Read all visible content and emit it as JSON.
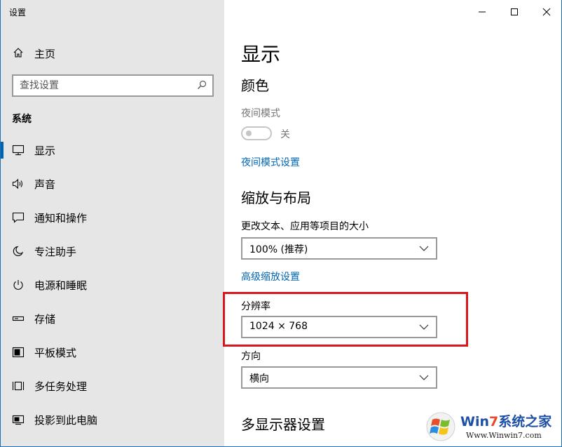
{
  "window": {
    "title": "设置",
    "controls": [
      "minimize",
      "maximize",
      "close"
    ]
  },
  "sidebar": {
    "home_label": "主页",
    "search_placeholder": "查找设置",
    "section_title": "系统",
    "items": [
      {
        "label": "显示",
        "icon": "monitor-icon",
        "active": true
      },
      {
        "label": "声音",
        "icon": "speaker-icon"
      },
      {
        "label": "通知和操作",
        "icon": "notification-icon"
      },
      {
        "label": "专注助手",
        "icon": "moon-icon"
      },
      {
        "label": "电源和睡眠",
        "icon": "power-icon"
      },
      {
        "label": "存储",
        "icon": "storage-icon"
      },
      {
        "label": "平板模式",
        "icon": "tablet-icon"
      },
      {
        "label": "多任务处理",
        "icon": "multitask-icon"
      },
      {
        "label": "投影到此电脑",
        "icon": "project-icon"
      }
    ]
  },
  "main": {
    "title": "显示",
    "color_section": {
      "title": "颜色",
      "night_light_label": "夜间模式",
      "toggle_state": "关",
      "night_light_settings_link": "夜间模式设置"
    },
    "scale_section": {
      "title": "缩放与布局",
      "scale_label": "更改文本、应用等项目的大小",
      "scale_value": "100% (推荐)",
      "advanced_scaling_link": "高级缩放设置",
      "resolution_label": "分辨率",
      "resolution_value": "1024 × 768",
      "orientation_label": "方向",
      "orientation_value": "横向"
    },
    "multi_display_title": "多显示器设置"
  },
  "watermark": {
    "brand_prefix": "Win",
    "brand_seven": "7",
    "brand_suffix": "系统之家",
    "url": "Www.Winwin7.com"
  },
  "colors": {
    "accent": "#0063b1",
    "link": "#0066b4",
    "highlight_box": "#d9161e",
    "sidebar_bg": "#e6e6e6"
  }
}
